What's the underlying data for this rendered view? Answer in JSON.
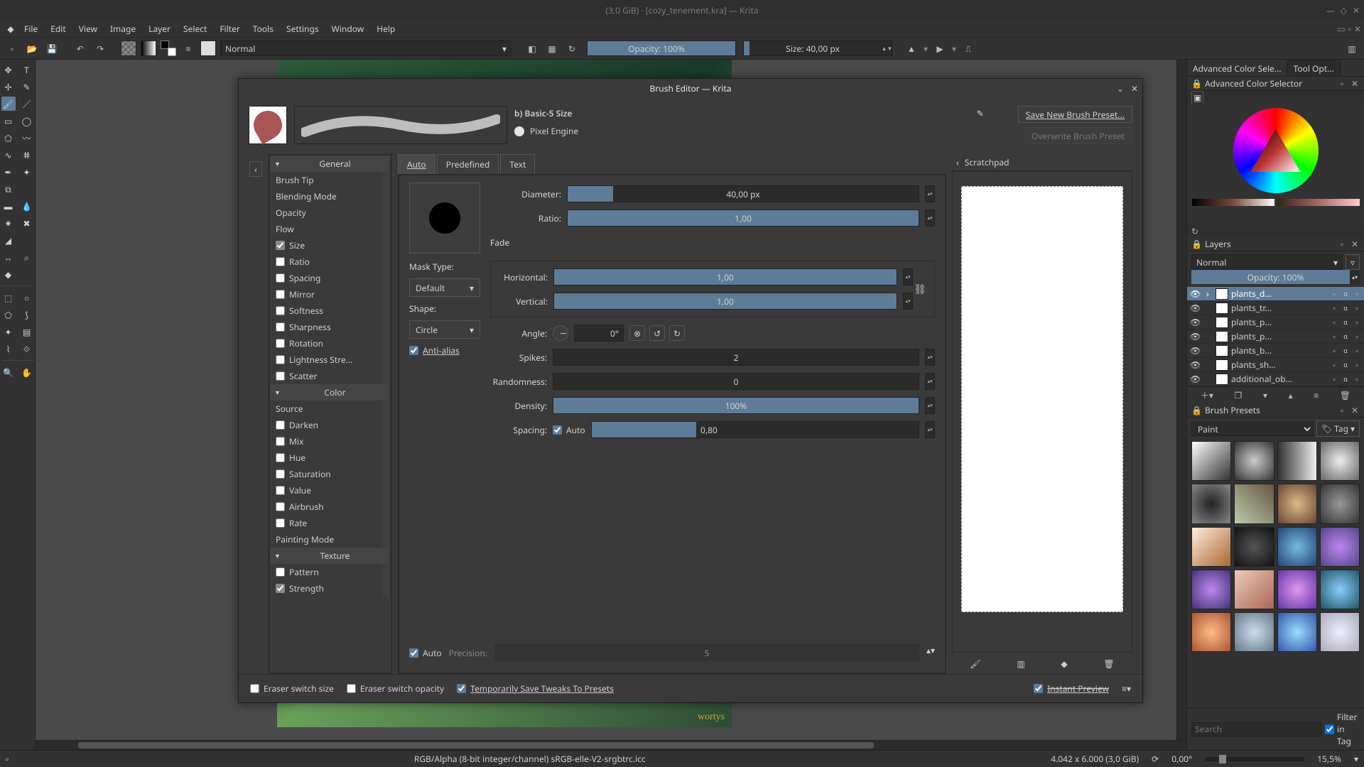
{
  "window": {
    "title": "(3,0 GiB) · [cozy_tenement.kra] — Krita"
  },
  "menubar": [
    "File",
    "Edit",
    "View",
    "Image",
    "Layer",
    "Select",
    "Filter",
    "Tools",
    "Settings",
    "Window",
    "Help"
  ],
  "toolbar": {
    "blend_mode": "Normal",
    "opacity_label": "Opacity: 100%",
    "size_label": "Size: 40,00 px"
  },
  "right_tabs": {
    "a": "Advanced Color Sele...",
    "b": "Tool Opt..."
  },
  "color_selector_title": "Advanced Color Selector",
  "layers": {
    "title": "Layers",
    "blend": "Normal",
    "opacity": "Opacity:  100%",
    "items": [
      {
        "name": "plants_d...",
        "sel": true
      },
      {
        "name": "plants_tr...",
        "sel": false
      },
      {
        "name": "plants_p...",
        "sel": false
      },
      {
        "name": "plants_p...",
        "sel": false
      },
      {
        "name": "plants_b...",
        "sel": false
      },
      {
        "name": "plants_sh...",
        "sel": false
      },
      {
        "name": "additional_ob...",
        "sel": false
      }
    ]
  },
  "presets": {
    "title": "Brush Presets",
    "category": "Paint",
    "tag_btn": "Tag",
    "search_placeholder": "Search",
    "filter_label": "Filter in Tag"
  },
  "statusbar": {
    "colorspace": "RGB/Alpha (8-bit integer/channel)  sRGB-elle-V2-srgbtrc.icc",
    "dims": "4.042 x 6.000 (3,0 GiB)",
    "angle": "0,00°",
    "zoom": "15,5%"
  },
  "canvas_signature": "wortys",
  "dialog": {
    "title": "Brush Editor — Krita",
    "preset_name": "b) Basic-5 Size",
    "engine": "Pixel Engine",
    "save_btn": "Save New Brush Preset...",
    "overwrite_btn": "Overwrite Brush Preset",
    "sections": {
      "general": "General",
      "color": "Color",
      "texture": "Texture"
    },
    "general_items": [
      {
        "label": "Brush Tip",
        "check": null
      },
      {
        "label": "Blending Mode",
        "check": null
      },
      {
        "label": "Opacity",
        "check": null
      },
      {
        "label": "Flow",
        "check": null
      },
      {
        "label": "Size",
        "check": true
      },
      {
        "label": "Ratio",
        "check": false
      },
      {
        "label": "Spacing",
        "check": false
      },
      {
        "label": "Mirror",
        "check": false
      },
      {
        "label": "Softness",
        "check": false
      },
      {
        "label": "Sharpness",
        "check": false
      },
      {
        "label": "Rotation",
        "check": false
      },
      {
        "label": "Lightness Stre...",
        "check": false
      },
      {
        "label": "Scatter",
        "check": false
      }
    ],
    "color_items": [
      {
        "label": "Source",
        "check": null
      },
      {
        "label": "Darken",
        "check": false
      },
      {
        "label": "Mix",
        "check": false
      },
      {
        "label": "Hue",
        "check": false
      },
      {
        "label": "Saturation",
        "check": false
      },
      {
        "label": "Value",
        "check": false
      },
      {
        "label": "Airbrush",
        "check": false
      },
      {
        "label": "Rate",
        "check": false
      },
      {
        "label": "Painting Mode",
        "check": null
      }
    ],
    "texture_items": [
      {
        "label": "Pattern",
        "check": false
      },
      {
        "label": "Strength",
        "check": true
      }
    ],
    "tabs": {
      "auto": "Auto",
      "predefined": "Predefined",
      "text": "Text"
    },
    "tip": {
      "diameter_label": "Diameter:",
      "diameter_val": "40,00 px",
      "diameter_fill": 13,
      "ratio_label": "Ratio:",
      "ratio_val": "1,00",
      "fade_label": "Fade",
      "mask_label": "Mask Type:",
      "mask_val": "Default",
      "shape_label": "Shape:",
      "shape_val": "Circle",
      "antialias": "Anti-alias",
      "horiz_label": "Horizontal:",
      "horiz_val": "1,00",
      "vert_label": "Vertical:",
      "vert_val": "1,00",
      "angle_label": "Angle:",
      "angle_val": "0°",
      "spikes_label": "Spikes:",
      "spikes_val": "2",
      "random_label": "Randomness:",
      "random_val": "0",
      "density_label": "Density:",
      "density_val": "100%",
      "spacing_label": "Spacing:",
      "spacing_auto": "Auto",
      "spacing_val": "0,80",
      "spacing_fill": 32
    },
    "precision": {
      "auto": "Auto",
      "label": "Precision:",
      "val": "5"
    },
    "scratchpad": "Scratchpad",
    "footer": {
      "eraser_size": "Eraser switch size",
      "eraser_opacity": "Eraser switch opacity",
      "temp_save": "Temporarily Save Tweaks To Presets",
      "instant": "Instant Preview"
    }
  }
}
